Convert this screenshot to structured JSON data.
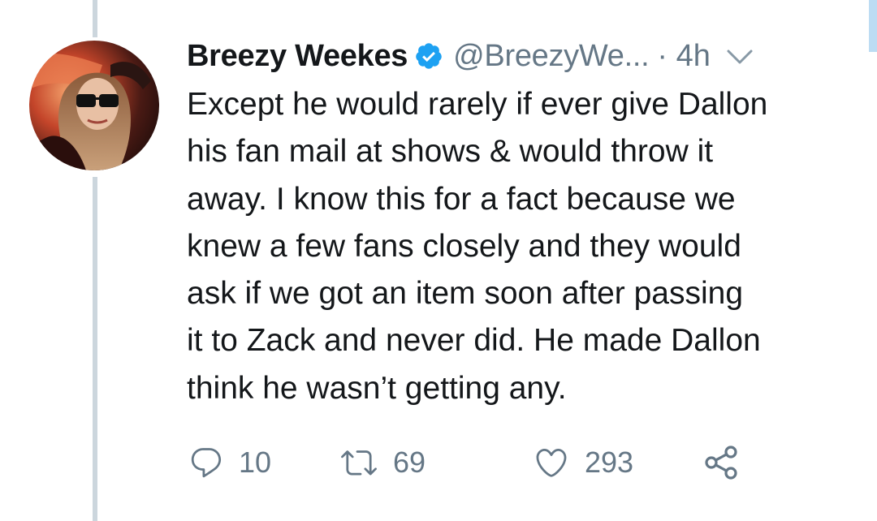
{
  "tweet": {
    "author": {
      "display_name": "Breezy Weekes",
      "handle": "@BreezyWe...",
      "verified": true,
      "avatar_icon": "profile-photo"
    },
    "time": "· 4h",
    "text_lines": [
      "Except he would rarely if ever give Dallon",
      "his fan mail at shows & would throw it",
      "away. I know this for a fact because we",
      "knew a few fans closely and they would",
      "ask if we got an item soon after passing",
      "it to Zack and never did. He made Dallon",
      "think he wasn’t getting any."
    ],
    "actions": {
      "replies": "10",
      "retweets": "69",
      "likes": "293"
    }
  },
  "colors": {
    "text": "#14171a",
    "secondary": "#657786",
    "verified_blue": "#1da1f2",
    "thread_line": "#ccd6dd"
  }
}
